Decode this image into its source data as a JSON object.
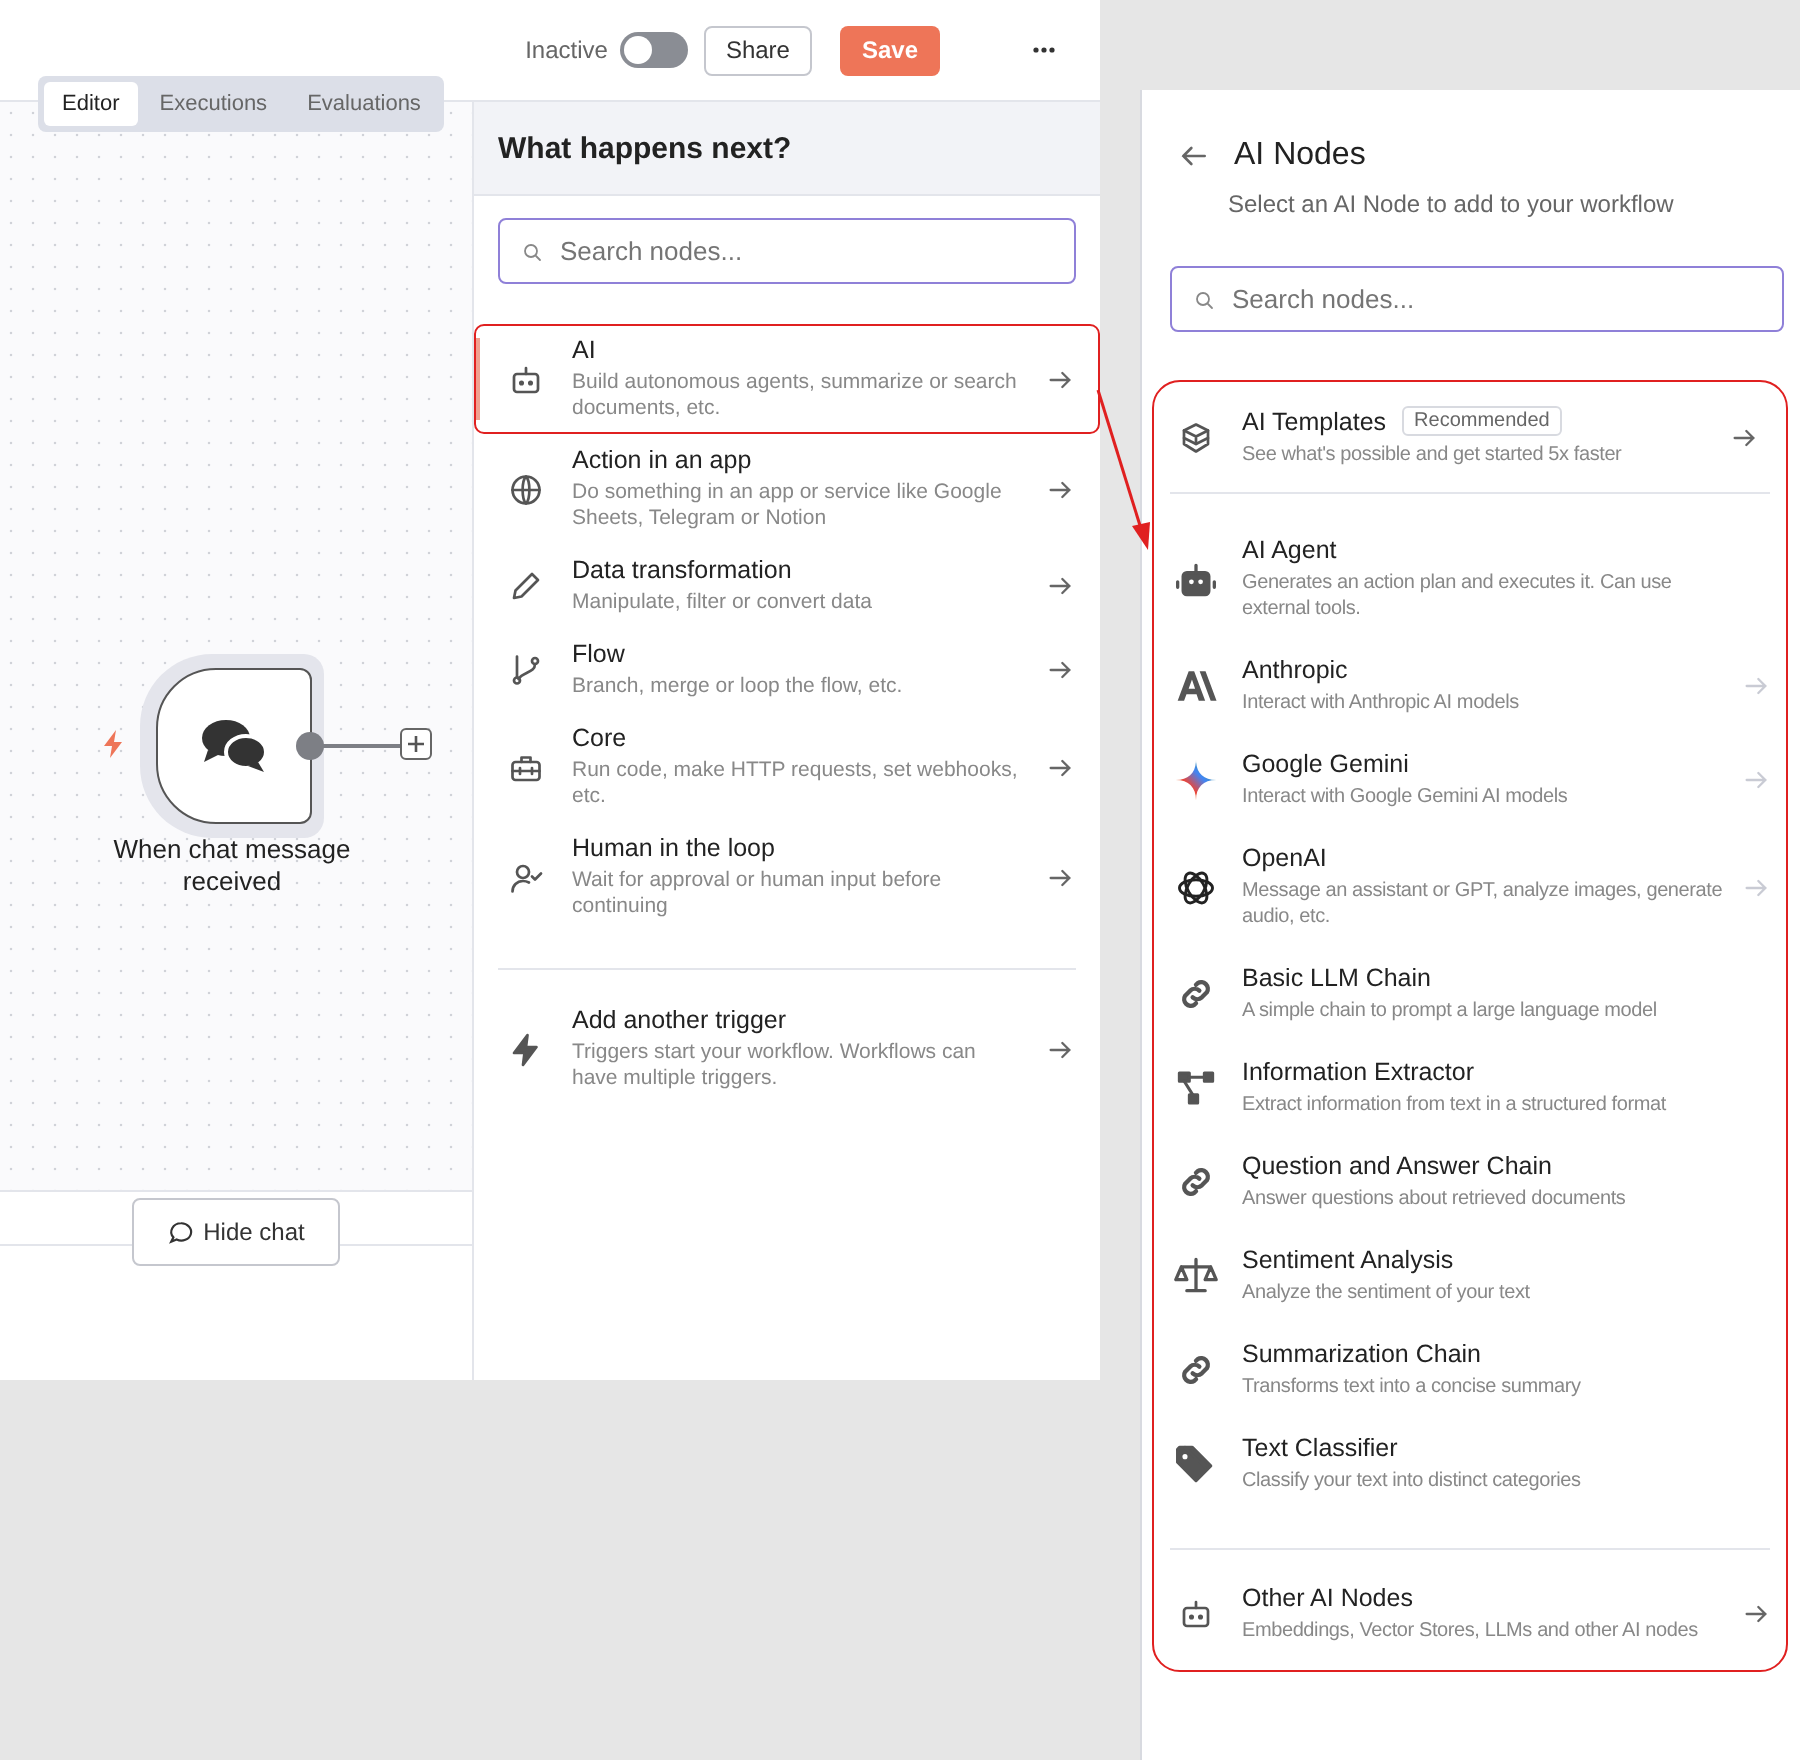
{
  "topbar": {
    "status": "Inactive",
    "active_toggle": {
      "on": false
    },
    "share": "Share",
    "save": "Save"
  },
  "tabs": [
    {
      "label": "Editor",
      "selected": true
    },
    {
      "label": "Executions",
      "selected": false
    },
    {
      "label": "Evaluations",
      "selected": false
    }
  ],
  "canvas": {
    "node": {
      "label": "When chat message received"
    },
    "hide_chat": "Hide chat"
  },
  "next_panel": {
    "title": "What happens next?",
    "search": {
      "placeholder": "Search nodes..."
    },
    "items": [
      {
        "kind": "robot",
        "title": "AI",
        "description": "Build autonomous agents, summarize or search documents, etc.",
        "selected": true,
        "highlighted": true
      },
      {
        "kind": "globe",
        "title": "Action in an app",
        "description": "Do something in an app or service like Google Sheets, Telegram or Notion",
        "selected": false,
        "highlighted": false
      },
      {
        "kind": "pencil",
        "title": "Data transformation",
        "description": "Manipulate, filter or convert data",
        "selected": false,
        "highlighted": false
      },
      {
        "kind": "branch",
        "title": "Flow",
        "description": "Branch, merge or loop the flow, etc.",
        "selected": false,
        "highlighted": false
      },
      {
        "kind": "toolbox",
        "title": "Core",
        "description": "Run code, make HTTP requests, set webhooks, etc.",
        "selected": false,
        "highlighted": false
      },
      {
        "kind": "person",
        "title": "Human in the loop",
        "description": "Wait for approval or human input before continuing",
        "selected": false,
        "highlighted": false
      }
    ],
    "trigger": {
      "kind": "bolt",
      "title": "Add another trigger",
      "description": "Triggers start your workflow. Workflows can have multiple triggers."
    }
  },
  "ai_panel": {
    "title": "AI Nodes",
    "subtitle": "Select an AI Node to add to your workflow",
    "search": {
      "placeholder": "Search nodes..."
    },
    "templates": {
      "kind": "box",
      "title": "AI Templates",
      "badge": "Recommended",
      "description": "See what's possible and get started 5x faster",
      "arrow": true,
      "dimmed": false
    },
    "nodes": [
      {
        "kind": "robot-solid",
        "title": "AI Agent",
        "description": "Generates an action plan and executes it. Can use external tools.",
        "arrow": false
      },
      {
        "kind": "anthropic",
        "title": "Anthropic",
        "description": "Interact with Anthropic AI models",
        "arrow": true,
        "dimmed": true
      },
      {
        "kind": "gemini",
        "title": "Google Gemini",
        "description": "Interact with Google Gemini AI models",
        "arrow": true,
        "dimmed": true
      },
      {
        "kind": "openai",
        "title": "OpenAI",
        "description": "Message an assistant or GPT, analyze images, generate audio, etc.",
        "arrow": true,
        "dimmed": true
      },
      {
        "kind": "link",
        "title": "Basic LLM Chain",
        "description": "A simple chain to prompt a large language model",
        "arrow": false
      },
      {
        "kind": "tree",
        "title": "Information Extractor",
        "description": "Extract information from text in a structured format",
        "arrow": false
      },
      {
        "kind": "link",
        "title": "Question and Answer Chain",
        "description": "Answer questions about retrieved documents",
        "arrow": false
      },
      {
        "kind": "scale",
        "title": "Sentiment Analysis",
        "description": "Analyze the sentiment of your text",
        "arrow": false
      },
      {
        "kind": "link",
        "title": "Summarization Chain",
        "description": "Transforms text into a concise summary",
        "arrow": false
      },
      {
        "kind": "tag",
        "title": "Text Classifier",
        "description": "Classify your text into distinct categories",
        "arrow": false
      }
    ],
    "other": {
      "kind": "robot",
      "title": "Other AI Nodes",
      "description": "Embeddings, Vector Stores, LLMs and other AI nodes",
      "arrow": true,
      "dimmed": false
    }
  }
}
